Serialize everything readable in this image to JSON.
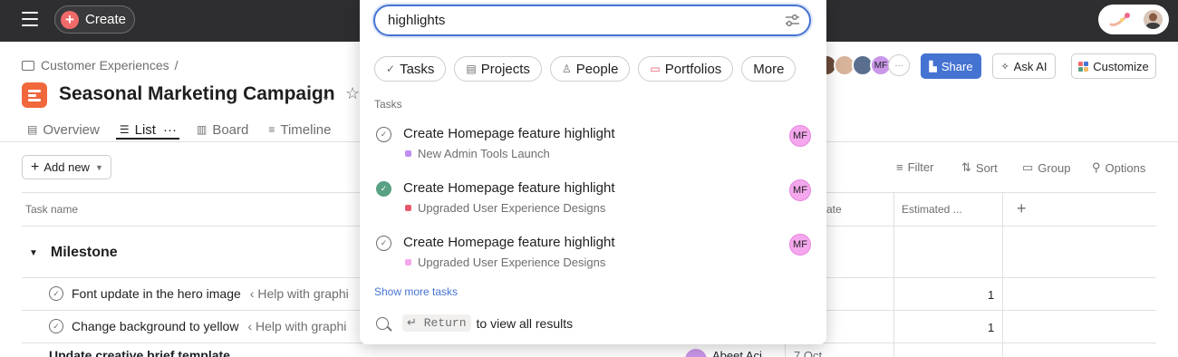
{
  "topbar": {
    "create_label": "Create",
    "menu_icon": "hamburger-icon",
    "avatar_initials": ""
  },
  "breadcrumb": {
    "label": "Customer Experiences",
    "separator": "/"
  },
  "project": {
    "title": "Seasonal Marketing Campaign",
    "icon_color": "#f1683c"
  },
  "tabs": [
    {
      "label": "Overview",
      "icon": "document-icon"
    },
    {
      "label": "List",
      "icon": "list-icon",
      "more": "···"
    },
    {
      "label": "Board",
      "icon": "board-icon"
    },
    {
      "label": "Timeline",
      "icon": "timeline-icon"
    }
  ],
  "header_actions": {
    "member_initials": "MF",
    "more": "···",
    "share_label": "Share",
    "ask_ai_label": "Ask AI",
    "customize_label": "Customize"
  },
  "toolbar": {
    "add_new_label": "Add new",
    "filter_label": "Filter",
    "sort_label": "Sort",
    "group_label": "Group",
    "options_label": "Options"
  },
  "table": {
    "columns": {
      "task_name": "Task name",
      "date": "ate",
      "estimated": "Estimated ..."
    },
    "add_column": "+",
    "section": "Milestone",
    "rows": [
      {
        "name": "Font update in the hero image",
        "parent": "‹ Help with graphi",
        "estimate": "1"
      },
      {
        "name": "Change background to yellow",
        "parent": "‹ Help with graphi",
        "estimate": "1"
      }
    ],
    "partial_row": {
      "name": "Update creative brief template",
      "assignee": "Abeet Aci",
      "date": "7 Oct"
    }
  },
  "search": {
    "query": "highlights",
    "chips": [
      {
        "label": "Tasks",
        "icon": "check-circle-icon"
      },
      {
        "label": "Projects",
        "icon": "clipboard-icon"
      },
      {
        "label": "People",
        "icon": "person-icon"
      },
      {
        "label": "Portfolios",
        "icon": "folder-icon"
      },
      {
        "label": "More",
        "icon": ""
      }
    ],
    "section_label": "Tasks",
    "results": [
      {
        "title": "Create Homepage feature highlight",
        "project": "New Admin Tools Launch",
        "dot_color": "#c18df0",
        "completed": false,
        "assignee": "MF"
      },
      {
        "title": "Create Homepage feature highlight",
        "project": "Upgraded User Experience Designs",
        "dot_color": "#e8596e",
        "completed": true,
        "assignee": "MF"
      },
      {
        "title": "Create Homepage feature highlight",
        "project": "Upgraded User Experience Designs",
        "dot_color": "#f4a7ec",
        "completed": false,
        "assignee": "MF"
      }
    ],
    "show_more": "Show more tasks",
    "return_key": "↵ Return",
    "return_hint": "to view all results"
  },
  "colors": {
    "accent": "#4573d2",
    "topbar": "#2e2e30",
    "create_plus": "#f06a6a",
    "done_green": "#58a182"
  }
}
